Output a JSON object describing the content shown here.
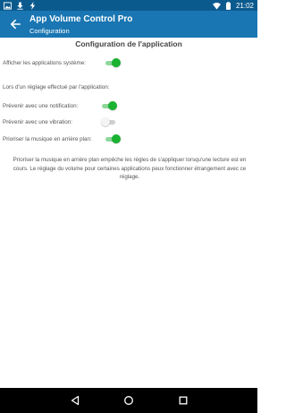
{
  "status_bar": {
    "time": "21:02",
    "icons": [
      "image-icon",
      "download-icon",
      "bolt-icon",
      "wifi-icon",
      "battery-icon"
    ]
  },
  "app_bar": {
    "title": "App Volume Control Pro",
    "subtitle": "Configuration",
    "back_icon": "arrow-left-icon"
  },
  "section": {
    "title": "Configuration de l'application"
  },
  "settings": {
    "show_system_apps": {
      "label": "Afficher les applications système:",
      "enabled": true
    },
    "on_apply_heading": "Lors d'un réglage effectué par l'application:",
    "notify": {
      "label": "Prévenir avec une notification:",
      "enabled": true
    },
    "vibrate": {
      "label": "Prévenir avec une vibration:",
      "enabled": false
    },
    "prioritize_music": {
      "label": "Prioriser la musique en arrière plan:",
      "enabled": true
    }
  },
  "note": "Prioriser la musique en arrière plan empêche les règles de s'appliquer lorsqu'une lecture est en cours. Le réglage du volume pour certaines applications peux fonctionner étrangement avec ce réglage.",
  "footer_note": "",
  "nav_bar": {
    "icons": [
      "back-triangle-icon",
      "home-circle-icon",
      "recents-square-icon"
    ]
  },
  "colors": {
    "status_bar": "#0b5a8e",
    "app_bar": "#1976b2",
    "switch_on": "#19b331",
    "switch_on_track": "#8fd79a",
    "switch_off_thumb": "#f4f4f4",
    "switch_off_track": "#cfcfcf"
  }
}
